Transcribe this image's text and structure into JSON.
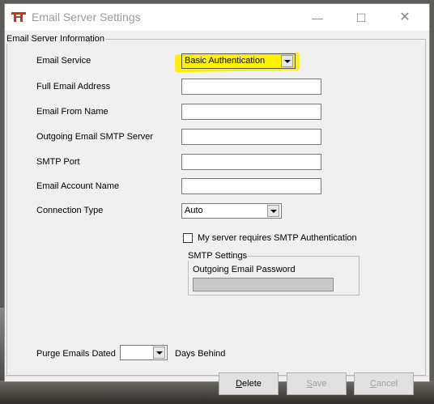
{
  "window": {
    "title": "Email Server Settings",
    "minimize_glyph": "—",
    "maximize_glyph": "☐",
    "close_glyph": "✕"
  },
  "group_main": {
    "legend": "Email Server Information"
  },
  "fields": {
    "email_service": {
      "label": "Email Service",
      "value": "Basic Authentication"
    },
    "full_email_address": {
      "label": "Full Email Address",
      "value": ""
    },
    "email_from_name": {
      "label": "Email From Name",
      "value": ""
    },
    "smtp_server": {
      "label": "Outgoing Email SMTP Server",
      "value": ""
    },
    "smtp_port": {
      "label": "SMTP Port",
      "value": ""
    },
    "email_account_name": {
      "label": "Email Account Name",
      "value": ""
    },
    "connection_type": {
      "label": "Connection Type",
      "value": "Auto"
    }
  },
  "smtp_auth_checkbox": {
    "label": "My server requires SMTP Authentication",
    "checked": false
  },
  "smtp_settings": {
    "legend": "SMTP Settings",
    "password_label": "Outgoing Email Password",
    "password_value": ""
  },
  "purge": {
    "label": "Purge Emails Dated",
    "value": "",
    "suffix": "Days Behind"
  },
  "buttons": {
    "delete": {
      "label": "Delete",
      "mnemonic": "D"
    },
    "save": {
      "label": "Save",
      "mnemonic": "S"
    },
    "cancel": {
      "label": "Cancel",
      "mnemonic": "C"
    }
  },
  "colors": {
    "highlight": "#fff200",
    "app_icon": "#c0391b"
  },
  "icons": [
    "app-icon",
    "chevron-down-icon",
    "minimize-icon",
    "maximize-icon",
    "close-icon"
  ]
}
